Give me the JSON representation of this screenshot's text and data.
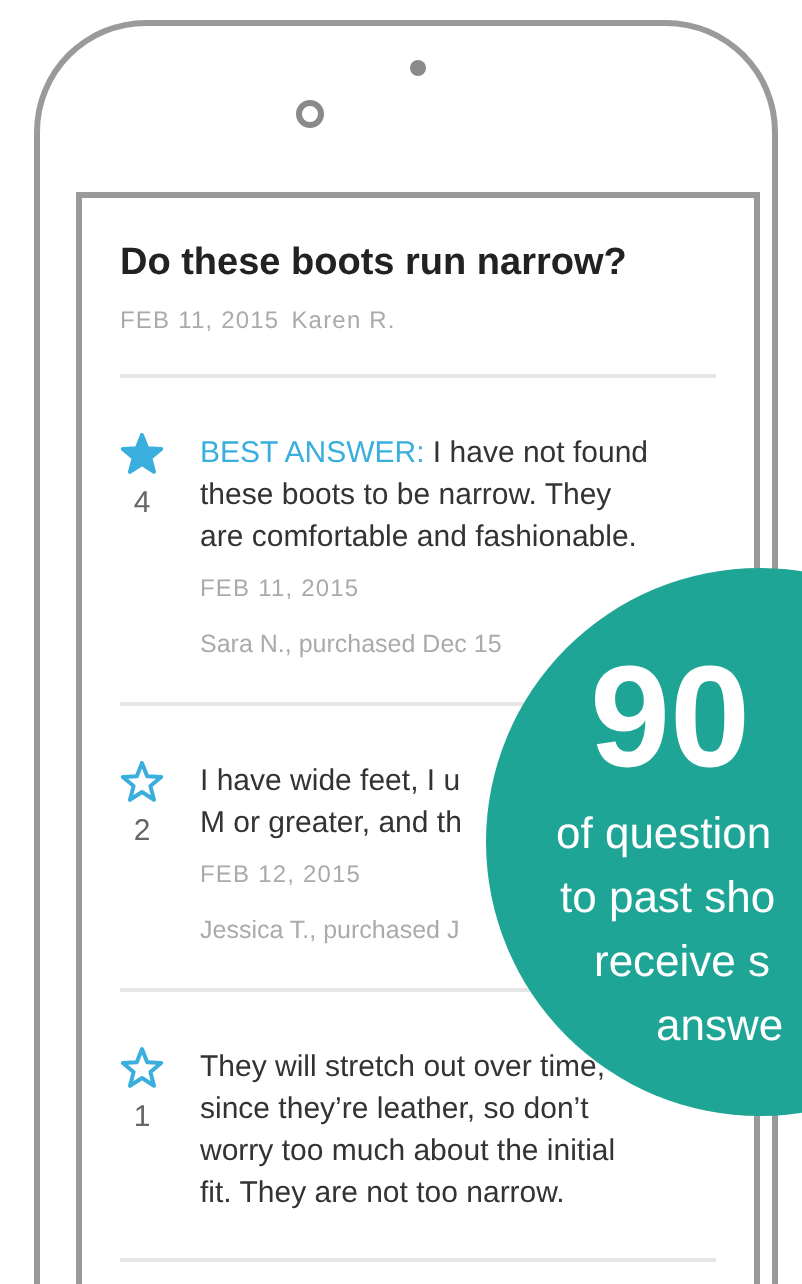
{
  "question": {
    "title": "Do these boots run narrow?",
    "date": "FEB 11, 2015",
    "author": "Karen R."
  },
  "answers": [
    {
      "best": true,
      "label": "BEST ANSWER:",
      "votes": "4",
      "text": "I have not found\nthese boots to be narrow. They\nare comfortable and fashionable.",
      "date": "FEB 11, 2015",
      "author": "Sara N., purchased Dec 15"
    },
    {
      "best": false,
      "votes": "2",
      "text": "I have wide feet, I u\nM or greater, and th",
      "date": "FEB 12, 2015",
      "author": "Jessica T., purchased J"
    },
    {
      "best": false,
      "votes": "1",
      "text": "They will stretch out over time,\nsince they’re leather, so don’t\nworry too much about the initial\nfit. They are not too narrow."
    }
  ],
  "promo": {
    "figure": "90",
    "lines": [
      "of question",
      "to past sho",
      "receive s",
      "answe"
    ]
  }
}
